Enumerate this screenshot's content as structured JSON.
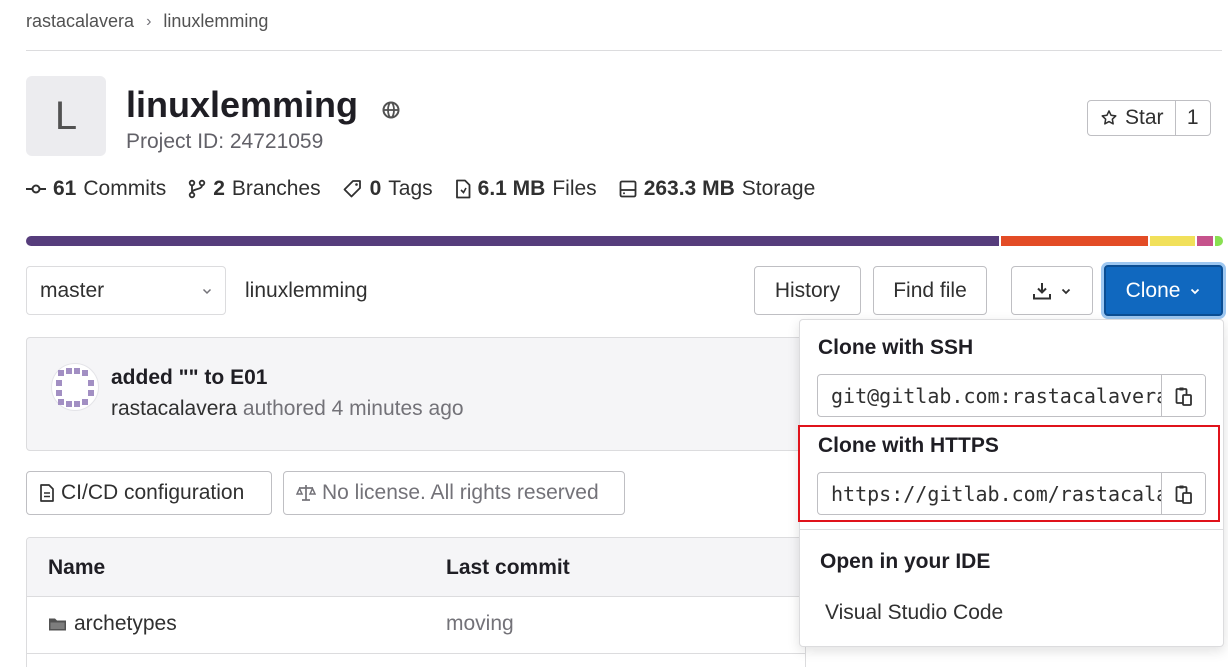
{
  "breadcrumb": {
    "group": "rastacalavera",
    "separator": "›",
    "project": "linuxlemming"
  },
  "project": {
    "avatar_letter": "L",
    "name": "linuxlemming",
    "visibility_icon": "globe-icon",
    "id_text": "Project ID: 24721059"
  },
  "star": {
    "label": "Star",
    "count": "1"
  },
  "stats": {
    "commits": {
      "value": "61",
      "label": "Commits"
    },
    "branches": {
      "value": "2",
      "label": "Branches"
    },
    "tags": {
      "value": "0",
      "label": "Tags"
    },
    "files": {
      "value": "6.1 MB",
      "label": "Files"
    },
    "storage": {
      "value": "263.3 MB",
      "label": "Storage"
    }
  },
  "languages": [
    {
      "color": "#563d7c",
      "share": 81.3
    },
    {
      "color": "#e34c26",
      "share": 12.2
    },
    {
      "color": "#f1e05a",
      "share": 3.8
    },
    {
      "color": "#c6538c",
      "share": 1.3
    },
    {
      "color": "#89e051",
      "share": 0.7
    }
  ],
  "controls": {
    "branch": "master",
    "path": "linuxlemming",
    "history": "History",
    "find_file": "Find file",
    "clone": "Clone"
  },
  "commit": {
    "title": "added \"\" to E01",
    "author": "rastacalavera",
    "meta": " authored 4 minutes ago"
  },
  "badges": {
    "cicd": "CI/CD configuration",
    "license": "No license. All rights reserved"
  },
  "table": {
    "headers": {
      "name": "Name",
      "last_commit": "Last commit"
    },
    "rows": [
      {
        "name": "archetypes",
        "last_commit": "moving"
      }
    ]
  },
  "clone_dropdown": {
    "ssh_label": "Clone with SSH",
    "ssh_url": "git@gitlab.com:rastacalavera/linuxlemming.git",
    "https_label": "Clone with HTTPS",
    "https_url": "https://gitlab.com/rastacalavera/linuxlemming.git",
    "ide_label": "Open in your IDE",
    "ide_item": "Visual Studio Code"
  },
  "colors": {
    "primary": "#1068bf",
    "highlight": "#e0131b"
  }
}
